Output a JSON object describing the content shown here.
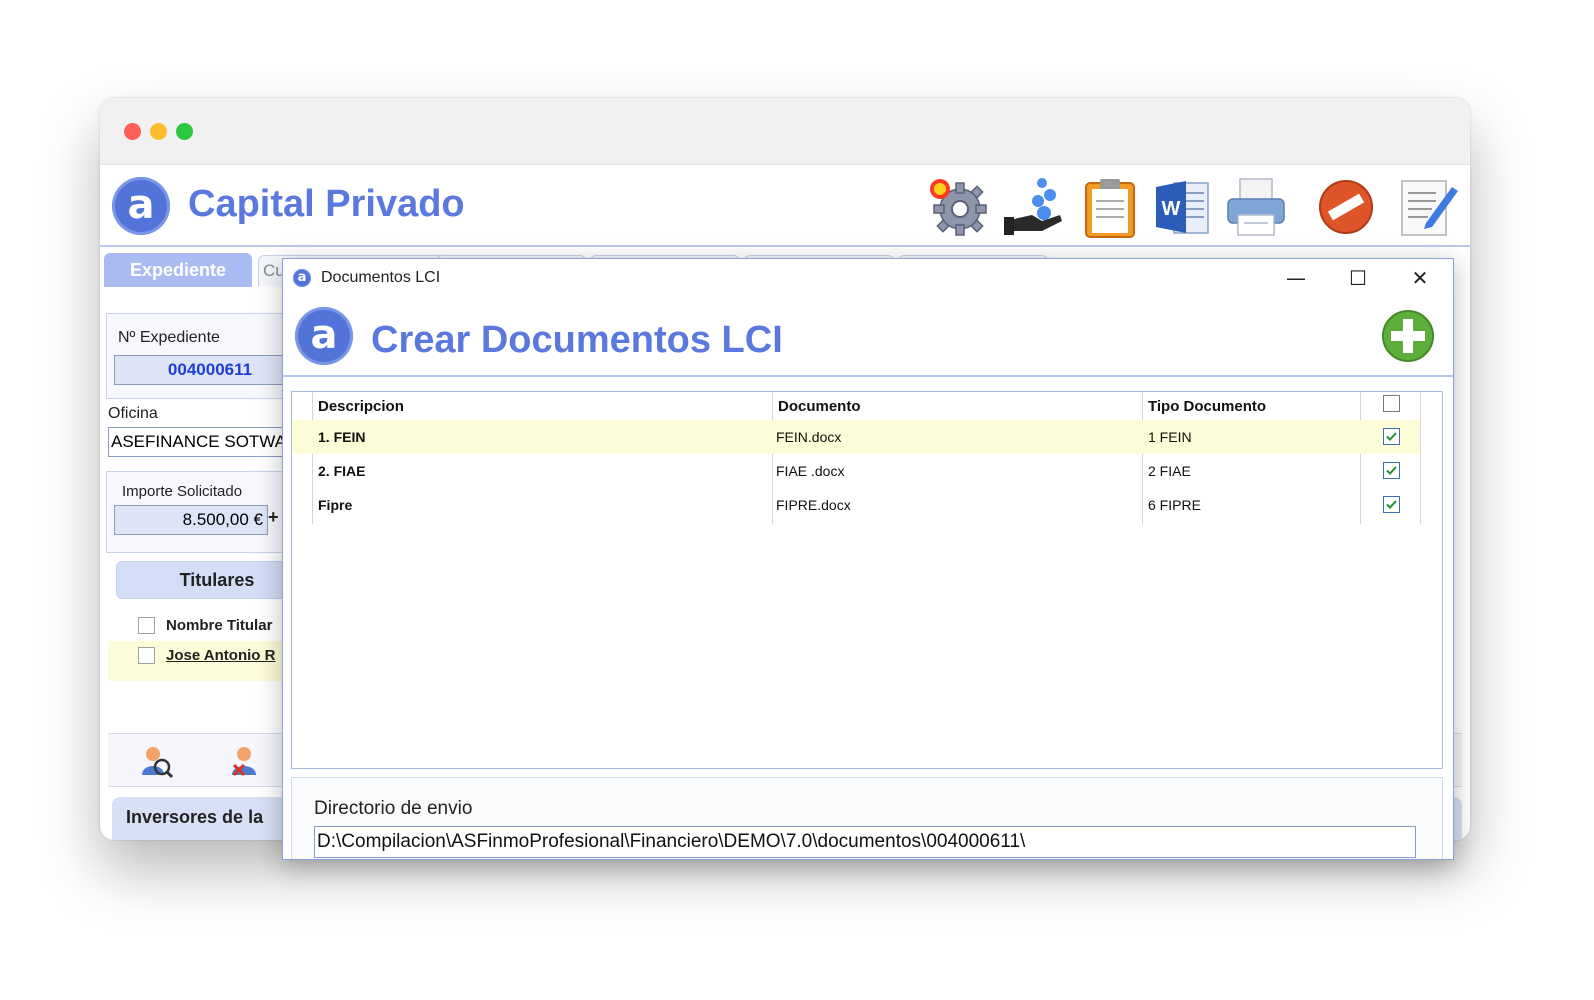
{
  "app": {
    "title": "Capital Privado",
    "logo_char": "a",
    "active_tab": "Expediente",
    "ghost_tab": "Cu"
  },
  "left": {
    "expediente_label": "Nº Expediente",
    "expediente_value": "004000611",
    "oficina_label": "Oficina",
    "oficina_value": "ASEFINANCE SOTWAR",
    "importe_label": "Importe Solicitado",
    "importe_value": "8.500,00 €",
    "plus": "+",
    "titulares_button": "Titulares",
    "col_nombre": "Nombre Titular",
    "titular_row": "Jose Antonio R",
    "inversores": "Inversores de la"
  },
  "dialog": {
    "title": "Documentos LCI",
    "heading": "Crear Documentos LCI",
    "logo_char": "a",
    "minimize": "—",
    "maximize": "☐",
    "close": "✕",
    "columns": [
      "Descripcion",
      "Documento",
      "Tipo Documento"
    ],
    "rows": [
      {
        "descripcion": "1. FEIN",
        "documento": "FEIN.docx",
        "tipo": "1 FEIN",
        "checked": true
      },
      {
        "descripcion": "2. FIAE",
        "documento": "FIAE .docx",
        "tipo": "2 FIAE",
        "checked": true
      },
      {
        "descripcion": "Fipre",
        "documento": "FIPRE.docx",
        "tipo": "6 FIPRE",
        "checked": true
      }
    ],
    "header_checked": false,
    "dir_label": "Directorio de envio",
    "dir_value": "D:\\Compilacion\\ASFinmoProfesional\\Financiero\\DEMO\\7.0\\documentos\\004000611\\"
  },
  "colors": {
    "accent": "#5a78dd",
    "selected_row": "#fdfcd8"
  },
  "icons": [
    "gear-icon",
    "money-hand-icon",
    "clipboard-icon",
    "word-icon",
    "printer-icon",
    "no-entry-icon",
    "edit-note-icon",
    "add-icon"
  ]
}
